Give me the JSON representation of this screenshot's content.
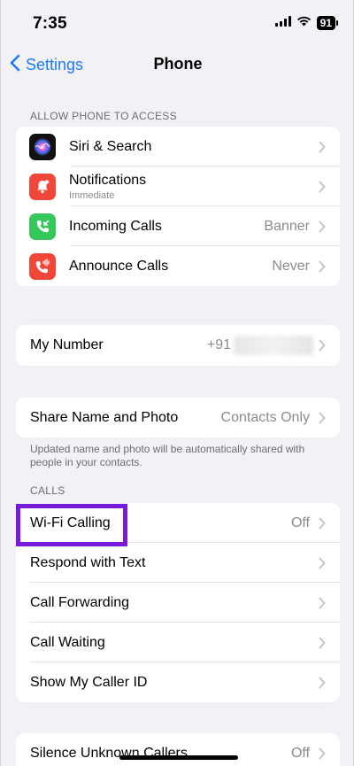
{
  "status_bar": {
    "time": "7:35",
    "battery": "91"
  },
  "nav": {
    "back_label": "Settings",
    "title": "Phone"
  },
  "sections": {
    "access_header": "ALLOW PHONE TO ACCESS",
    "calls_header": "CALLS"
  },
  "access_rows": [
    {
      "label": "Siri & Search",
      "icon": "siri-icon"
    },
    {
      "label": "Notifications",
      "sublabel": "Immediate",
      "icon": "notification-bell-icon"
    },
    {
      "label": "Incoming Calls",
      "value": "Banner",
      "icon": "incoming-call-icon"
    },
    {
      "label": "Announce Calls",
      "value": "Never",
      "icon": "announce-call-icon"
    }
  ],
  "my_number": {
    "label": "My Number",
    "value_prefix": "+91"
  },
  "share": {
    "label": "Share Name and Photo",
    "value": "Contacts Only",
    "footer": "Updated name and photo will be automatically shared with people in your contacts."
  },
  "call_rows": [
    {
      "label": "Wi-Fi Calling",
      "value": "Off"
    },
    {
      "label": "Respond with Text"
    },
    {
      "label": "Call Forwarding"
    },
    {
      "label": "Call Waiting"
    },
    {
      "label": "Show My Caller ID"
    }
  ],
  "silence": {
    "label": "Silence Unknown Callers",
    "value": "Off"
  },
  "colors": {
    "accent": "#1b7cf5",
    "highlight": "#7a19d9",
    "notifications_icon": "#f24638",
    "incoming_icon": "#34c759",
    "announce_icon": "#f24638"
  }
}
